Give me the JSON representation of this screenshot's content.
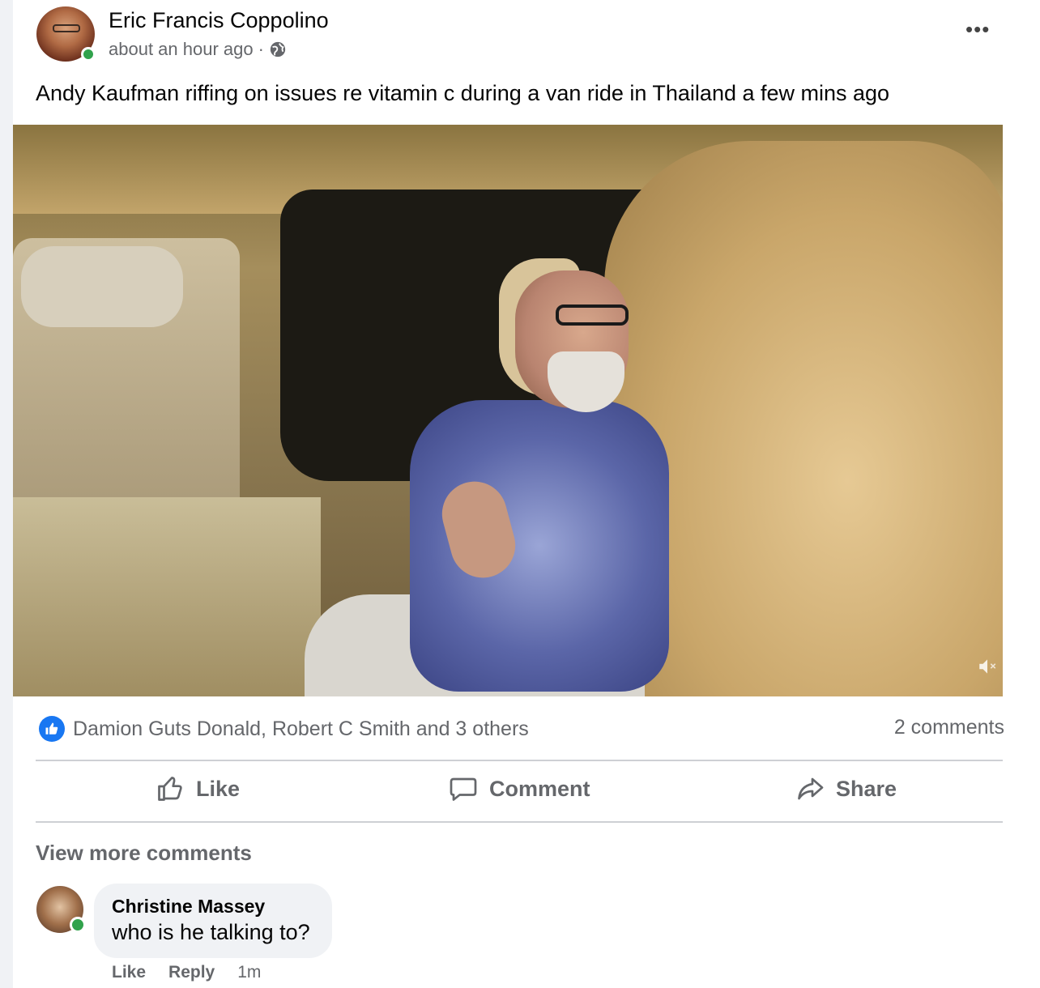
{
  "post": {
    "author": "Eric Francis Coppolino",
    "timestamp": "about an hour ago",
    "separator": "·",
    "audience_icon": "globe-icon",
    "more_icon": "•••",
    "text": "Andy Kaufman riffing on issues re vitamin c during a van ride in Thailand a few mins ago"
  },
  "video": {
    "volume_icon": "volume-muted-icon"
  },
  "engagement": {
    "reactions_text": "Damion Guts Donald, Robert C Smith and 3 others",
    "comments_count": "2 comments"
  },
  "actions": {
    "like": "Like",
    "comment": "Comment",
    "share": "Share"
  },
  "comments": {
    "view_more": "View more comments",
    "items": [
      {
        "author": "Christine Massey",
        "text": "who is he talking to?",
        "like": "Like",
        "reply": "Reply",
        "time": "1m"
      }
    ]
  },
  "colors": {
    "facebook_blue": "#1877f2",
    "online_green": "#31a24c",
    "secondary_text": "#65676b"
  }
}
